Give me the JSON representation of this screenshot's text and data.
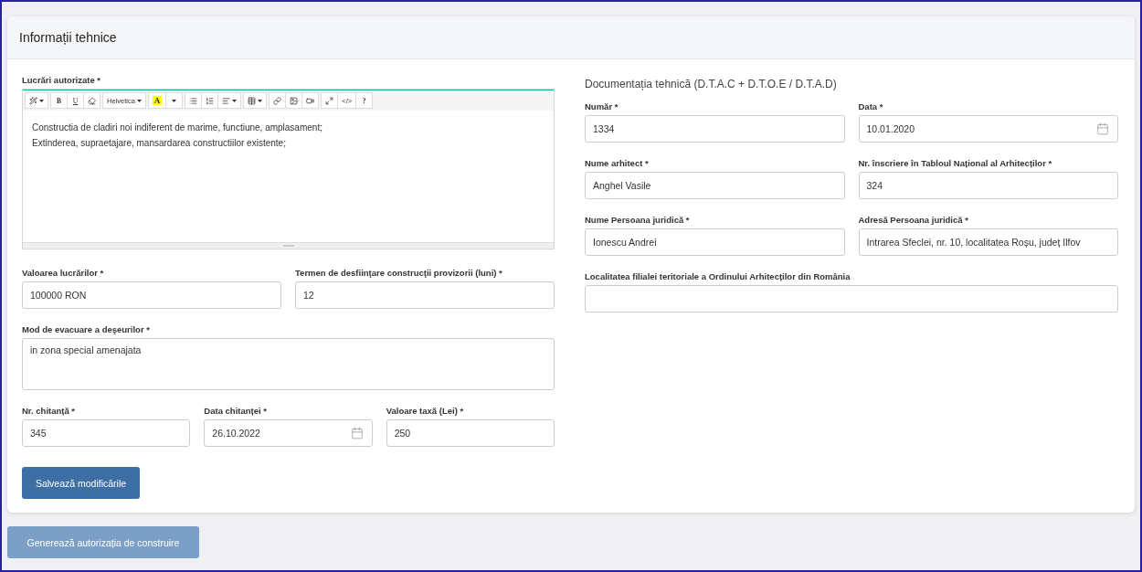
{
  "card": {
    "title": "Informații tehnice"
  },
  "editor": {
    "label": "Lucrări autorizate *",
    "toolbar": [
      [
        {
          "kind": "wand"
        }
      ],
      [
        {
          "kind": "bold",
          "label": "B"
        },
        {
          "kind": "underline",
          "label": "U"
        },
        {
          "kind": "eraser"
        }
      ],
      [
        {
          "kind": "dropdown",
          "label": "Helvetica"
        }
      ],
      [
        {
          "kind": "color",
          "label": "A"
        },
        {
          "kind": "caret"
        }
      ],
      [
        {
          "kind": "list-ul"
        },
        {
          "kind": "list-ol"
        },
        {
          "kind": "align"
        }
      ],
      [
        {
          "kind": "table"
        }
      ],
      [
        {
          "kind": "link"
        },
        {
          "kind": "picture"
        },
        {
          "kind": "video"
        }
      ],
      [
        {
          "kind": "fullscreen"
        },
        {
          "kind": "text",
          "label": "</>"
        },
        {
          "kind": "bold",
          "label": "?"
        }
      ]
    ],
    "lines": [
      "Constructia de cladiri noi indiferent de marime, functiune, amplasament;",
      "Extinderea, supraetajare, mansardarea constructiilor existente;"
    ]
  },
  "left_rows": [
    [
      {
        "label": "Valoarea lucrărilor *",
        "value": "100000 RON"
      },
      {
        "label": "Termen de desfiinţare construcţii provizorii (luni) *",
        "value": "12"
      }
    ],
    [
      {
        "label": "Mod de evacuare a deşeurilor *",
        "value": "in zona special amenajata",
        "kind": "textarea"
      }
    ],
    [
      {
        "label": "Nr. chitanță *",
        "value": "345"
      },
      {
        "label": "Data chitanței *",
        "value": "26.10.2022",
        "kind": "date"
      },
      {
        "label": "Valoare taxă (Lei) *",
        "value": "250"
      }
    ]
  ],
  "save_button": "Salvează modificările",
  "documentation": {
    "title": "Documentația tehnică (D.T.A.C + D.T.O.E / D.T.A.D)",
    "rows": [
      [
        {
          "label": "Număr *",
          "value": "1334"
        },
        {
          "label": "Data *",
          "value": "10.01.2020",
          "kind": "date"
        }
      ],
      [
        {
          "label": "Nume arhitect *",
          "value": "Anghel Vasile"
        },
        {
          "label": "Nr. înscriere în Tabloul Național al Arhitecților *",
          "value": "324"
        }
      ],
      [
        {
          "label": "Nume Persoana juridică *",
          "value": "Ionescu Andrei"
        },
        {
          "label": "Adresă Persoana juridică *",
          "value": "Intrarea Sfeclei, nr. 10, localitatea Roșu, județ Ilfov"
        }
      ],
      [
        {
          "label": "Localitatea filialei teritoriale a Ordinului Arhitecților din România"
        }
      ]
    ]
  },
  "generate_button": {
    "label": "Generează autorizația de construire",
    "disabled": true
  }
}
